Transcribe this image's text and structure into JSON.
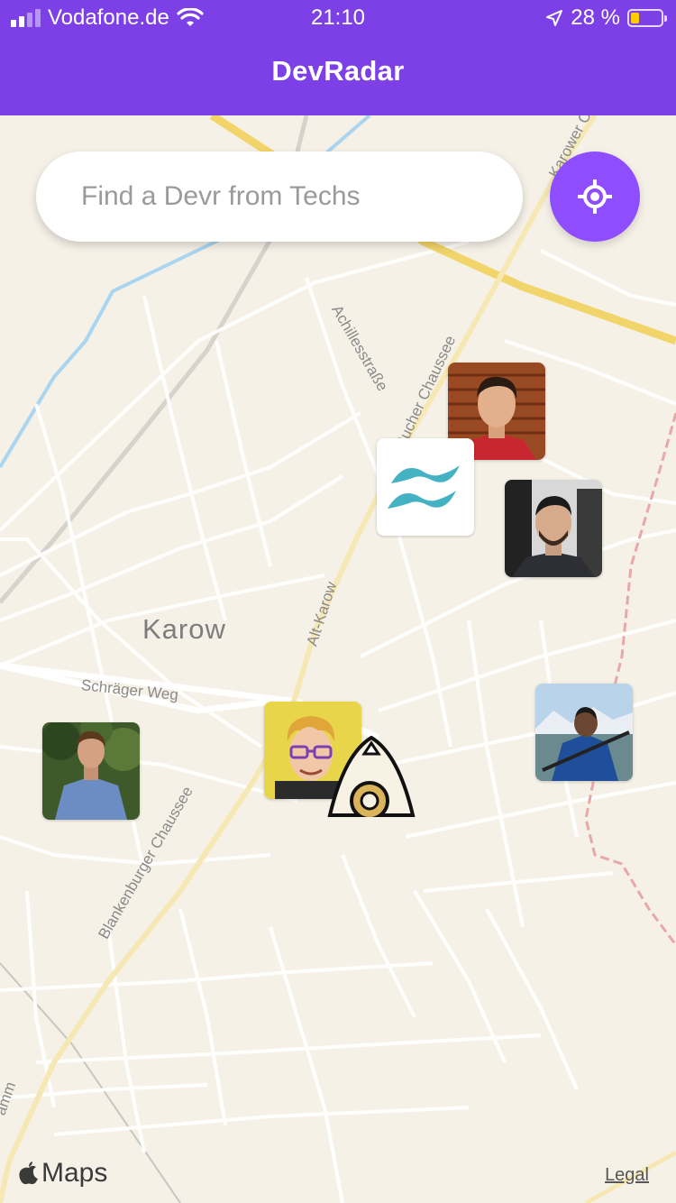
{
  "status_bar": {
    "carrier": "Vodafone.de",
    "time": "21:10",
    "battery_percent": "28 %",
    "battery_level": 0.28,
    "battery_color": "#ffcc00"
  },
  "header": {
    "title": "DevRadar",
    "background": "#7d40e7"
  },
  "search": {
    "placeholder": "Find a Devr from Techs",
    "value": ""
  },
  "locate_button": {
    "icon": "crosshair-icon",
    "color": "#8e4dff"
  },
  "map": {
    "labels": {
      "karow": "Karow",
      "schraeger_weg": "Schräger Weg",
      "alt_karow": "Alt-Karow",
      "bucher_chaussee": "Bucher Chaussee",
      "achillesstrasse": "Achillesstraße",
      "blankenburger_chaussee": "Blankenburger Chaussee",
      "karower_chaussee": "Karower C",
      "damm": "amm"
    }
  },
  "devs": [
    {
      "name": "dev-avatar-1",
      "kind": "photo"
    },
    {
      "name": "dev-avatar-tailwind",
      "kind": "logo"
    },
    {
      "name": "dev-avatar-2",
      "kind": "photo"
    },
    {
      "name": "dev-avatar-3",
      "kind": "photo"
    },
    {
      "name": "dev-avatar-4",
      "kind": "photo"
    },
    {
      "name": "dev-avatar-cartoon",
      "kind": "cartoon"
    }
  ],
  "footer": {
    "maps_logo": "Maps",
    "legal": "Legal"
  }
}
